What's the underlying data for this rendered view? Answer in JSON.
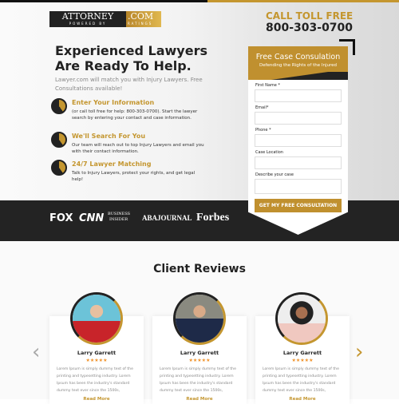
{
  "logo": {
    "main": "ATTORNEY",
    "dotcom": ".COM",
    "powered": "POWERED BY",
    "ratings": "RATINGS"
  },
  "hero": {
    "title": "Experienced Lawyers Are Ready To Help.",
    "subtitle": "Lawyer.com will match you with Injury Lawyers. Free Consultations available!",
    "steps": [
      {
        "title": "Enter Your Information",
        "text": "(or call toll free for help: 800-303-0700). Start the lawyer search by entering your contact and case information."
      },
      {
        "title": "We'll Search For You",
        "text": "Our team will reach out to top Injury Lawyers and email you with their contact information."
      },
      {
        "title": "24/7 Lawyer Matching",
        "text": "Talk to Injury Lawyers, protect your rights, and get legal help!"
      }
    ]
  },
  "call": {
    "label": "CALL TOLL FREE",
    "number": "800-303-0700"
  },
  "form": {
    "title": "Free Case Consulation",
    "subtitle": "Defending the Rights of the Injured",
    "fields": [
      "First Name *",
      "Email*",
      "Phone *",
      "Case Location",
      "Describe your case"
    ],
    "submit": "GET MY FREE CONSULTATION"
  },
  "media": [
    "FOX",
    "CNN",
    "BUSINESS",
    "INSIDER",
    "ABAJOURNAL",
    "Forbes"
  ],
  "reviews": {
    "title": "Client Reviews",
    "stars": "★★★★★",
    "rating": 5,
    "items": [
      {
        "name": "Larry Garrett",
        "text": "Lorem Ipsum is simply dummy text of the printing and typesetting industry. Lorem Ipsum has been the industry's standard dummy text ever since the 1500s,",
        "more": "Read More"
      },
      {
        "name": "Larry Garrett",
        "text": "Lorem Ipsum is simply dummy text of the printing and typesetting industry. Lorem Ipsum has been the industry's standard dummy text ever since the 1500s,",
        "more": "Read More"
      },
      {
        "name": "Larry Garrett",
        "text": "Lorem Ipsum is simply dummy text of the printing and typesetting industry. Lorem Ipsum has been the industry's standard dummy text ever since the 1500s,",
        "more": "Read More"
      }
    ]
  },
  "colors": {
    "accent": "#c4962f",
    "dark": "#232323",
    "star": "#f0922a"
  }
}
